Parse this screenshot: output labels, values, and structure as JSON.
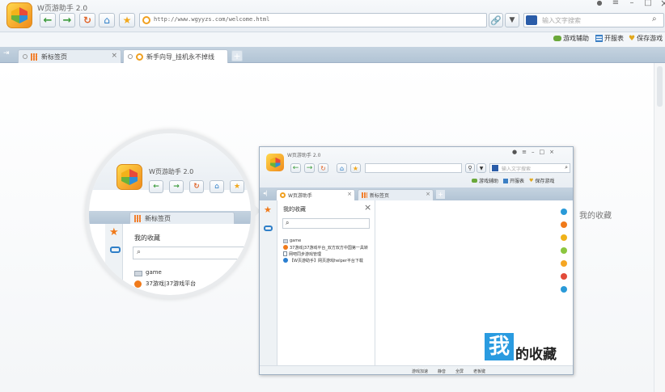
{
  "window": {
    "title": "W页游助手 2.0",
    "controls": [
      "●",
      "≡",
      "–",
      "□",
      "×"
    ]
  },
  "address": {
    "url": "http://www.wgyyzs.com/welcome.html"
  },
  "search": {
    "placeholder": "输入文字搜索"
  },
  "bookmarks": [
    {
      "label": "游戏辅助",
      "color": "#6aa83a"
    },
    {
      "label": "开服表",
      "color": "#3b7fc4"
    },
    {
      "label": "保存游戏",
      "color": "#e2a81c"
    }
  ],
  "tabs": [
    {
      "label": "新标签页"
    },
    {
      "label": "新手向导_挂机永不掉线"
    }
  ],
  "inner": {
    "title": "W页游助手 2.0",
    "tabs": [
      {
        "label": "W页游助手"
      },
      {
        "label": "新标签页"
      }
    ],
    "sidebar_title": "我的收藏",
    "favorites": [
      {
        "icon": "folder",
        "text": "game"
      },
      {
        "icon": "orange",
        "text": "37游戏|37游戏平台_双方双方中国第一具转"
      },
      {
        "icon": "page",
        "text": "网吧同步游戏管理"
      },
      {
        "icon": "ie",
        "text": "【W页游助手】网页游戏helper平台下载"
      }
    ],
    "statusbar": [
      "游戏加速",
      "静音",
      "全屏",
      "老板键"
    ],
    "callout_big": "我",
    "callout_rest": "的收藏",
    "dots": [
      "#2a9ad8",
      "#f07a1a",
      "#f0b21a",
      "#8cc63f",
      "#f5a623",
      "#e24b3a",
      "#2a9ad8"
    ]
  },
  "zoom": {
    "title": "W页游助手 2.0",
    "tab": "新标签页",
    "sidebar_title": "我的收藏",
    "fav1": "game",
    "fav2": "37游戏|37游戏平台"
  },
  "outer_label": "我的收藏"
}
